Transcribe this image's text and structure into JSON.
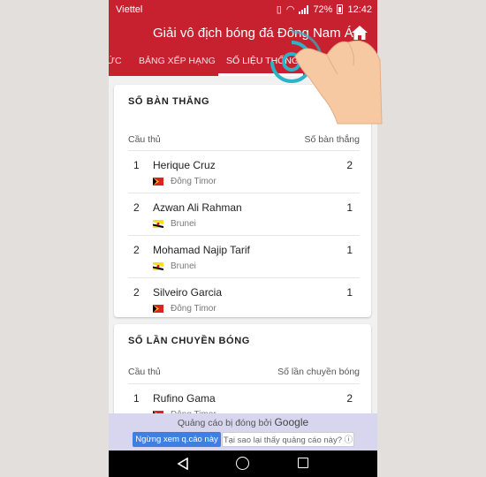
{
  "status_bar": {
    "carrier": "Viettel",
    "battery": "72%",
    "time": "12:42"
  },
  "app_bar": {
    "title": "Giải vô địch bóng đá Đông Nam Á"
  },
  "tabs": [
    {
      "label": "ỨC"
    },
    {
      "label": "BẢNG XẾP HẠNG"
    },
    {
      "label": "SỐ LIỆU THỐNG KÊ"
    }
  ],
  "goals": {
    "title": "SỐ BÀN THẮNG",
    "col_player": "Cầu thủ",
    "col_value": "Số bàn thắng",
    "rows": [
      {
        "rank": "1",
        "name": "Herique Cruz",
        "country": "Đông Timor",
        "value": "2"
      },
      {
        "rank": "2",
        "name": "Azwan Ali Rahman",
        "country": "Brunei",
        "value": "1"
      },
      {
        "rank": "2",
        "name": "Mohamad Najip Tarif",
        "country": "Brunei",
        "value": "1"
      },
      {
        "rank": "2",
        "name": "Silveiro Garcia",
        "country": "Đông Timor",
        "value": "1"
      }
    ]
  },
  "assists": {
    "title": "SỐ LẦN CHUYỀN BÓNG",
    "col_player": "Cầu thủ",
    "col_value": "Số lần chuyền bóng",
    "rows": [
      {
        "rank": "1",
        "name": "Rufino Gama",
        "country": "Đông Timor",
        "value": "2"
      }
    ]
  },
  "ad": {
    "text": "Quảng cáo bị đóng bởi",
    "brand": "Google",
    "stop_label": "Ngừng xem q.cáo này",
    "why_label": "Tại sao lại thấy quảng cáo này? ⓘ"
  },
  "colors": {
    "primary": "#c7202f",
    "ad_bg": "#d8d5ee",
    "tap_ring": "#2bb3c8"
  }
}
